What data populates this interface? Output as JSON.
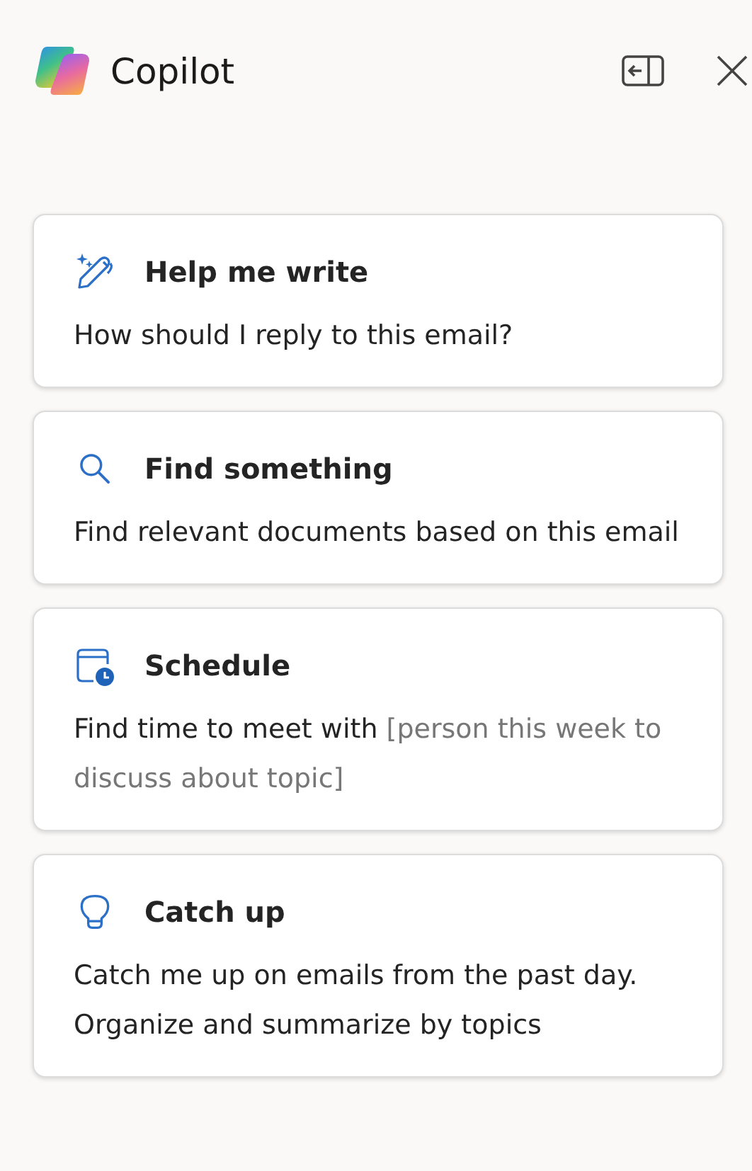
{
  "header": {
    "title": "Copilot"
  },
  "cards": [
    {
      "kind": "write",
      "title": "Help me write",
      "text": "How should I reply to this email?"
    },
    {
      "kind": "find",
      "title": "Find something",
      "text": "Find relevant documents based on this email"
    },
    {
      "kind": "schedule",
      "title": "Schedule",
      "text": "Find time to meet with ",
      "hint": "[person this week to discuss about topic]"
    },
    {
      "kind": "catchup",
      "title": "Catch up",
      "text": "Catch me up on emails from the past day. Organize and summarize by topics"
    }
  ]
}
